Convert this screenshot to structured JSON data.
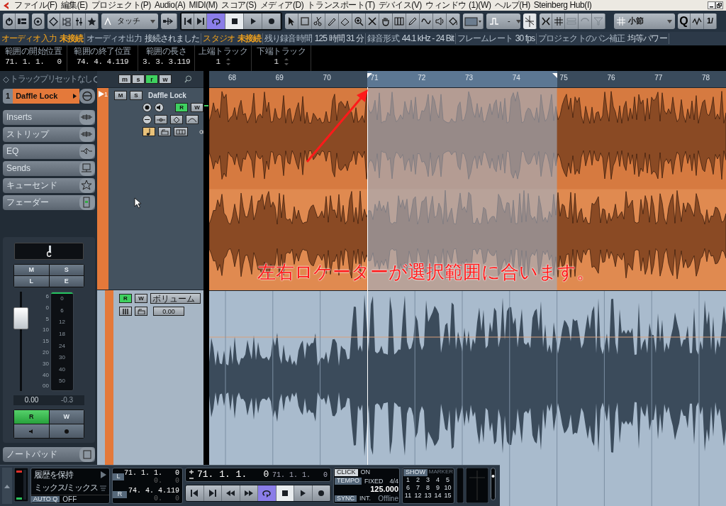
{
  "menu_bar": {
    "items": [
      "ファイル(F)",
      "編集(E)",
      "プロジェクト(P)",
      "Audio(A)",
      "MIDI(M)",
      "スコア(S)",
      "メディア(D)",
      "トランスポート(T)",
      "デバイス(V)",
      "ウィンドウ (1)(W)",
      "ヘルプ(H)",
      "Steinberg Hub(I)"
    ]
  },
  "toolbar": {
    "automation_mode": "タッチ",
    "transport_buttons": [
      {
        "kind": "start",
        "on": false
      },
      {
        "kind": "end",
        "on": false
      },
      {
        "kind": "cycle",
        "on": true
      },
      {
        "kind": "stop",
        "on": true
      },
      {
        "kind": "play",
        "on": false
      },
      {
        "kind": "record",
        "on": false
      }
    ],
    "grid_value": "-",
    "snap_type": "小節",
    "quantize_label": "Q",
    "quantize_value": "1/"
  },
  "status_line": [
    {
      "label": "オーディオ入力",
      "value": "未接続",
      "alert": true
    },
    {
      "label": "オーディオ出力",
      "value": "接続されました",
      "alert": false
    },
    {
      "label": "スタジオ",
      "value": "未接続",
      "alert": true
    },
    {
      "label": "残り録音時間",
      "value": "125 時間 31 分",
      "alert": false
    },
    {
      "label": "録音形式",
      "value": "44.1 kHz - 24 Bit",
      "alert": false
    },
    {
      "label": "フレームレート",
      "value": "30 fps",
      "alert": false
    },
    {
      "label": "プロジェクトのパン補正",
      "value": "均等パワー",
      "alert": false
    }
  ],
  "info_line": [
    {
      "kind": "time",
      "label": "範囲の開始位置",
      "value": "71. 1. 1.   0"
    },
    {
      "kind": "time",
      "label": "範囲の終了位置",
      "value": "74. 4. 4.119"
    },
    {
      "kind": "time",
      "label": "範囲の長さ",
      "value": "3. 3. 3.119"
    },
    {
      "kind": "spin",
      "label": "上端トラック",
      "value": "1"
    },
    {
      "kind": "spin",
      "label": "下端トラック",
      "value": "1"
    }
  ],
  "inspector": {
    "preset": "トラックプリセットなし",
    "track_number": "1",
    "track_name": "Daffle Lock",
    "sections": [
      "Inserts",
      "ストリップ",
      "EQ",
      "Sends",
      "キューセンド",
      "フェーダー"
    ],
    "pan": "C",
    "channel_buttons": [
      "M",
      "S",
      "L",
      "E"
    ],
    "fader_scale": [
      "6",
      "0",
      "5",
      "10",
      "15",
      "20",
      "30",
      "40",
      "00"
    ],
    "meter_scale": [
      "0",
      "6",
      "12",
      "18",
      "24",
      "30",
      "40",
      "50"
    ],
    "fader": {
      "level": 0.8
    },
    "volume": "0.00",
    "peak": "-0.3",
    "automation_buttons": [
      {
        "kind": "text",
        "label": "R",
        "on": true
      },
      {
        "kind": "text",
        "label": "W",
        "on": false
      },
      {
        "kind": "monitor",
        "on": false
      },
      {
        "kind": "record",
        "on": false
      }
    ],
    "notepad": "ノートパッド"
  },
  "track_list": {
    "header_buttons": [
      {
        "label": "m",
        "on": false
      },
      {
        "label": "s",
        "on": false
      },
      {
        "label": "r",
        "on": true
      },
      {
        "label": "w",
        "on": false
      }
    ],
    "track": {
      "number": "1",
      "name": "Daffle Lock",
      "selected": true,
      "buttons": [
        {
          "label": "M",
          "on": false
        },
        {
          "label": "S",
          "on": false
        }
      ],
      "rw": [
        {
          "label": "R",
          "on": true
        },
        {
          "label": "W",
          "on": false
        }
      ],
      "musical": true
    },
    "automation_lane": {
      "rw": [
        {
          "label": "R",
          "on": true
        },
        {
          "label": "W",
          "on": false
        }
      ],
      "parameter": "ボリューム",
      "value": "0.00"
    }
  },
  "ruler": [
    {
      "label": "68",
      "in_range": false
    },
    {
      "label": "69",
      "in_range": false
    },
    {
      "label": "70",
      "in_range": false
    },
    {
      "label": "71",
      "in_range": true
    },
    {
      "label": "72",
      "in_range": true
    },
    {
      "label": "73",
      "in_range": true
    },
    {
      "label": "74",
      "in_range": true
    },
    {
      "label": "75",
      "in_range": false
    },
    {
      "label": "76",
      "in_range": false
    },
    {
      "label": "77",
      "in_range": false
    },
    {
      "label": "78",
      "in_range": false
    }
  ],
  "annotation": "左右ロケーターが選択範囲に合います。",
  "transport_panel": {
    "history": "履歴を保持",
    "mix": "ミックス/ミックス",
    "autoq_label": "AUTO Q",
    "autoq_value": "OFF",
    "locators": [
      {
        "label": "L",
        "position": "71. 1. 1.   0",
        "offset": "0.   0"
      },
      {
        "label": "R",
        "position": "74. 4. 4.119",
        "offset": "0.   0"
      }
    ],
    "primary_position": "71. 1. 1.   0",
    "secondary_position": "71. 1. 1.   0",
    "buttons": [
      {
        "kind": "start",
        "on": false
      },
      {
        "kind": "end",
        "on": false
      },
      {
        "kind": "rewind",
        "on": false
      },
      {
        "kind": "forward",
        "on": false
      },
      {
        "kind": "cycle",
        "on": true
      },
      {
        "kind": "stop",
        "on": true
      },
      {
        "kind": "play",
        "on": false
      },
      {
        "kind": "record",
        "on": false
      }
    ],
    "click": {
      "label": "CLICK",
      "value": "ON"
    },
    "tempo": {
      "label": "TEMPO",
      "mode": "FIXED",
      "signature": "4/4",
      "value": "125.000"
    },
    "sync": {
      "label": "SYNC",
      "mode": "INT.",
      "value": "Offline"
    },
    "marker": {
      "show": "SHOW",
      "label": "MARKER",
      "numbers": [
        "1",
        "2",
        "3",
        "4",
        "5",
        "6",
        "7",
        "8",
        "9",
        "10",
        "11",
        "12",
        "13",
        "14",
        "15"
      ]
    }
  }
}
